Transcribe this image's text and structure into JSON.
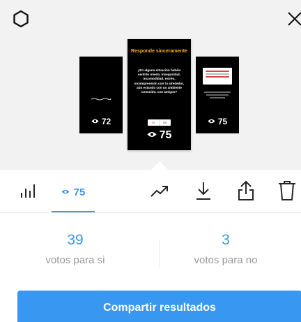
{
  "header": {
    "settings_icon": "settings-icon",
    "close_icon": "close-icon"
  },
  "stories": {
    "left": {
      "views": "72"
    },
    "center": {
      "views": "75",
      "title": "Responde sinceramente",
      "question": "¿En alguna situación habéis sentido miedo, inseguridad, incomodidad, estrés, incomprensión con tu alrededor, aún estando con un ambiente conocido, con amigos?",
      "poll_yes": "SI",
      "poll_no": "NO"
    },
    "right": {
      "views": "75"
    }
  },
  "toolbar": {
    "viewers_count": "75",
    "icons": [
      "bar-chart-icon",
      "eye-icon",
      "trending-up-icon",
      "download-icon",
      "share-icon",
      "trash-icon"
    ]
  },
  "results": {
    "yes_count": "39",
    "yes_label": "votos para si",
    "no_count": "3",
    "no_label": "votos para no"
  },
  "share_button": {
    "label": "Compartir resultados"
  },
  "colors": {
    "accent": "#3897f0",
    "title_yellow": "#f5b11b",
    "background": "#f2f2f2"
  }
}
